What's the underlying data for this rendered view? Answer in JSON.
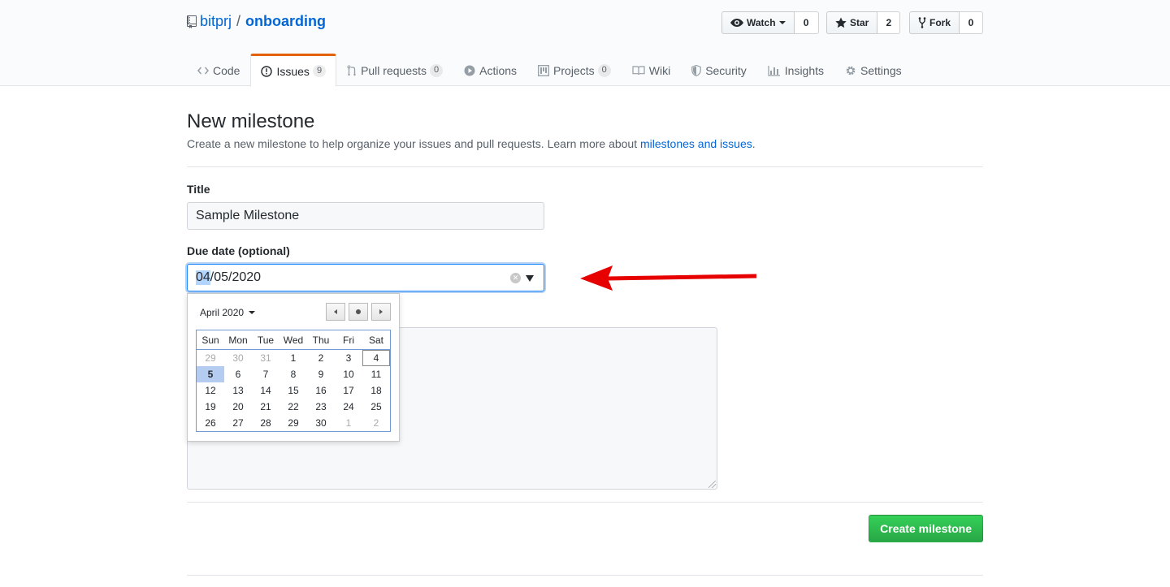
{
  "repo": {
    "owner": "bitprj",
    "separator": "/",
    "name": "onboarding"
  },
  "actions": {
    "watch": {
      "label": "Watch",
      "count": "0"
    },
    "star": {
      "label": "Star",
      "count": "2"
    },
    "fork": {
      "label": "Fork",
      "count": "0"
    }
  },
  "tabs": [
    {
      "label": "Code",
      "icon": "code-icon"
    },
    {
      "label": "Issues",
      "icon": "issue-icon",
      "counter": "9",
      "selected": true
    },
    {
      "label": "Pull requests",
      "icon": "pull-request-icon",
      "counter": "0"
    },
    {
      "label": "Actions",
      "icon": "play-icon"
    },
    {
      "label": "Projects",
      "icon": "project-icon",
      "counter": "0"
    },
    {
      "label": "Wiki",
      "icon": "book-icon"
    },
    {
      "label": "Security",
      "icon": "shield-icon"
    },
    {
      "label": "Insights",
      "icon": "graph-icon"
    },
    {
      "label": "Settings",
      "icon": "gear-icon"
    }
  ],
  "page": {
    "title": "New milestone",
    "subtitle": "Create a new milestone to help organize your issues and pull requests. Learn more about ",
    "subtitle_link": "milestones and issues",
    "subtitle_end": "."
  },
  "form": {
    "title_label": "Title",
    "title_value": "Sample Milestone",
    "due_label": "Due date (optional)",
    "due_month": "04",
    "due_rest": "/05/2020",
    "submit_label": "Create milestone"
  },
  "calendar": {
    "month_label": "April 2020",
    "weekdays": [
      "Sun",
      "Mon",
      "Tue",
      "Wed",
      "Thu",
      "Fri",
      "Sat"
    ],
    "weeks": [
      [
        "29",
        "30",
        "31",
        "1",
        "2",
        "3",
        "4"
      ],
      [
        "5",
        "6",
        "7",
        "8",
        "9",
        "10",
        "11"
      ],
      [
        "12",
        "13",
        "14",
        "15",
        "16",
        "17",
        "18"
      ],
      [
        "19",
        "20",
        "21",
        "22",
        "23",
        "24",
        "25"
      ],
      [
        "26",
        "27",
        "28",
        "29",
        "30",
        "1",
        "2"
      ]
    ],
    "selected_day": "5",
    "today_day": "4"
  },
  "colors": {
    "accent": "#0366d6",
    "tab_highlight": "#e36209",
    "primary_button": "#28a745",
    "annotation_arrow": "#e60000"
  }
}
